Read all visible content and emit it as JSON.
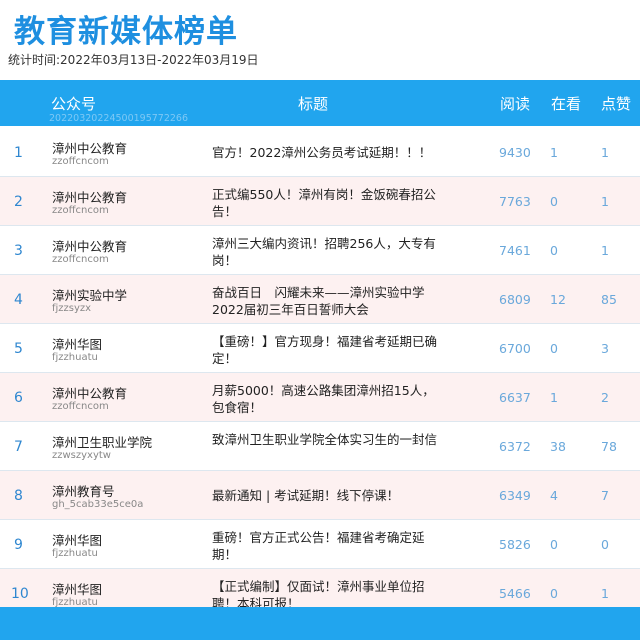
{
  "page_title": "教育新媒体榜单",
  "period": "统计时间:2022年03月13日-2022年03月19日",
  "header": {
    "account": "公众号",
    "title": "标题",
    "reads": "阅读",
    "watching": "在看",
    "likes": "点赞",
    "id": "20220320224500195772266"
  },
  "rows": [
    {
      "rank": "1",
      "name": "漳州中公教育",
      "account": "zzoffcncom",
      "title": "官方！2022漳州公务员考试延期！！！",
      "reads": "9430",
      "watching": "1",
      "likes": "1"
    },
    {
      "rank": "2",
      "name": "漳州中公教育",
      "account": "zzoffcncom",
      "title": "正式编550人！漳州有岗！金饭碗春招公告！",
      "reads": "7763",
      "watching": "0",
      "likes": "1"
    },
    {
      "rank": "3",
      "name": "漳州中公教育",
      "account": "zzoffcncom",
      "title": "漳州三大编内资讯！招聘256人，大专有岗！",
      "reads": "7461",
      "watching": "0",
      "likes": "1"
    },
    {
      "rank": "4",
      "name": "漳州实验中学",
      "account": "fjzzsyzx",
      "title": "奋战百日　闪耀未来——漳州实验中学2022届初三年百日誓师大会",
      "reads": "6809",
      "watching": "12",
      "likes": "85"
    },
    {
      "rank": "5",
      "name": "漳州华图",
      "account": "fjzzhuatu",
      "title": "【重磅！】官方现身！福建省考延期已确定！",
      "reads": "6700",
      "watching": "0",
      "likes": "3"
    },
    {
      "rank": "6",
      "name": "漳州中公教育",
      "account": "zzoffcncom",
      "title": "月薪5000！高速公路集团漳州招15人，包食宿！",
      "reads": "6637",
      "watching": "1",
      "likes": "2"
    },
    {
      "rank": "7",
      "name": "漳州卫生职业学院",
      "account": "zzwszyxytw",
      "title": "致漳州卫生职业学院全体实习生的一封信",
      "reads": "6372",
      "watching": "38",
      "likes": "78"
    },
    {
      "rank": "8",
      "name": "漳州教育号",
      "account": "gh_5cab33e5ce0a",
      "title": "最新通知 | 考试延期！线下停课！",
      "reads": "6349",
      "watching": "4",
      "likes": "7"
    },
    {
      "rank": "9",
      "name": "漳州华图",
      "account": "fjzzhuatu",
      "title": "重磅！官方正式公告！福建省考确定延期！",
      "reads": "5826",
      "watching": "0",
      "likes": "0"
    },
    {
      "rank": "10",
      "name": "漳州华图",
      "account": "fjzzhuatu",
      "title": "【正式编制】仅面试！漳州事业单位招聘！本科可报！",
      "reads": "5466",
      "watching": "0",
      "likes": "1"
    }
  ]
}
